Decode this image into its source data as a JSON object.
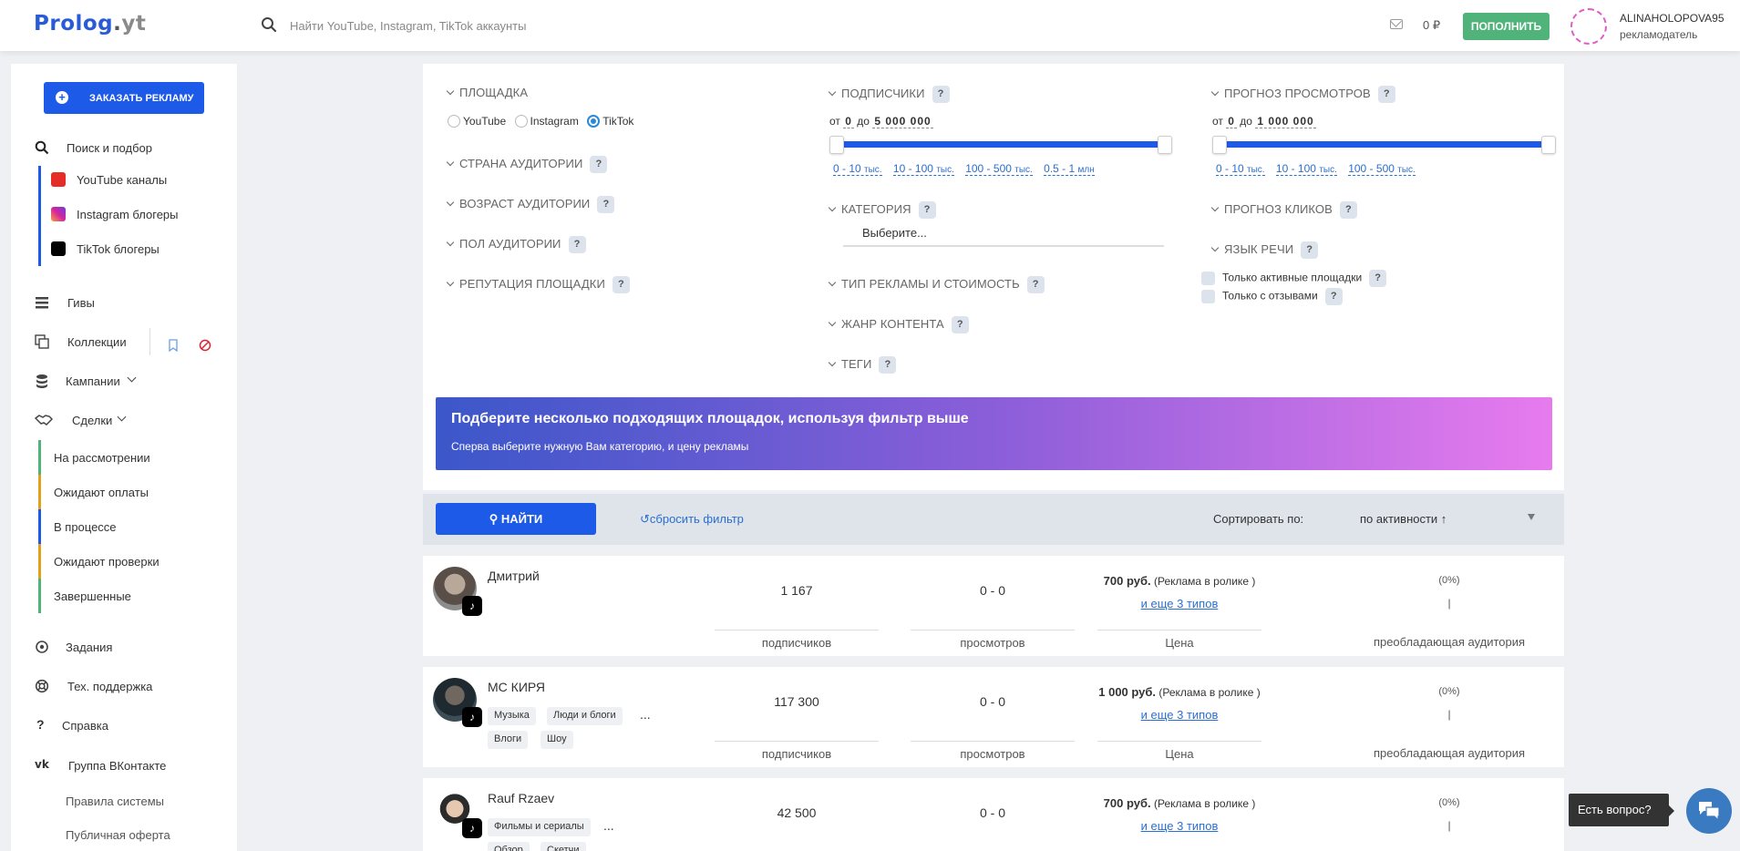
{
  "header": {
    "logo": "Prolog",
    "logo_dot": ".",
    "logo_suffix": "yt",
    "search_placeholder": "Найти YouTube, Instagram, TikTok аккаунты",
    "balance": "0 ₽",
    "topup_label": "ПОПОЛНИТЬ",
    "user_name": "ALINAHOLOPOVA95",
    "user_role": "рекламодатель"
  },
  "sidebar": {
    "order_label": "ЗАКАЗАТЬ РЕКЛАМУ",
    "search": "Поиск и подбор",
    "platforms": [
      "YouTube каналы",
      "Instagram блогеры",
      "TikTok блогеры"
    ],
    "giveaways": "Гивы",
    "collections": "Коллекции",
    "campaigns": "Кампании",
    "deals": "Сделки",
    "deal_states": [
      "На рассмотрении",
      "Ожидают оплаты",
      "В процессе",
      "Ожидают проверки",
      "Завершенные"
    ],
    "deal_colors": [
      "#4fb37a",
      "#e0a11b",
      "#1e5ae8",
      "#e0a11b",
      "#4fb37a"
    ],
    "tasks": "Задания",
    "support": "Тех. поддержка",
    "help": "Справка",
    "vk_group": "Группа ВКонтакте",
    "rules": "Правила системы",
    "offer": "Публичная оферта"
  },
  "filters": {
    "platform_title": "ПЛОЩАДКА",
    "platform_options": [
      "YouTube",
      "Instagram",
      "TikTok"
    ],
    "platform_selected": "TikTok",
    "country": "СТРАНА АУДИТОРИИ",
    "age": "ВОЗРАСТ АУДИТОРИИ",
    "gender": "ПОЛ АУДИТОРИИ",
    "reputation": "РЕПУТАЦИЯ ПЛОЩАДКИ",
    "subscribers_title": "ПОДПИСЧИКИ",
    "sub_from_lbl": "от",
    "sub_from": "0",
    "sub_to_lbl": "до",
    "sub_to": "5 000 000",
    "sub_presets": [
      "0 - 10",
      "10 - 100",
      "100 - 500",
      "0.5 - 1"
    ],
    "sub_units": [
      "тыс.",
      "тыс.",
      "тыс.",
      "млн"
    ],
    "category_title": "КАТЕГОРИЯ",
    "category_placeholder": "Выберите...",
    "ad_type": "ТИП РЕКЛАМЫ И СТОИМОСТЬ",
    "genre": "ЖАНР КОНТЕНТА",
    "tags": "ТЕГИ",
    "views_title": "ПРОГНОЗ ПРОСМОТРОВ",
    "views_from_lbl": "от",
    "views_from": "0",
    "views_to_lbl": "до",
    "views_to": "1 000 000",
    "views_presets": [
      "0 - 10",
      "10 - 100",
      "100 - 500"
    ],
    "views_units": [
      "тыс.",
      "тыс.",
      "тыс."
    ],
    "clicks_title": "ПРОГНОЗ КЛИКОВ",
    "language_title": "ЯЗЫК РЕЧИ",
    "only_active": "Только активные площадки",
    "only_reviews": "Только с отзывами",
    "help_mark": "?"
  },
  "banner": {
    "title": "Подберите несколько подходящих площадок, используя фильтр выше",
    "subtitle": "Сперва выберите нужную Вам категорию, и цену рекламы"
  },
  "toolbar": {
    "find_label": "НАЙТИ",
    "reset_label": "сбросить фильтр",
    "sort_label": "Сортировать по:",
    "sort_value": "по активности ↑"
  },
  "labels": {
    "subscribers": "подписчиков",
    "views": "просмотров",
    "price": "Цена",
    "audience": "преобладающая аудитория",
    "more_types": "и еще 3 типов",
    "pct": "(0%)",
    "bar": "|",
    "ellipsis": "..."
  },
  "cards": [
    {
      "name": "Дмитрий",
      "subscribers": "1 167",
      "views": "0 - 0",
      "price": "700 руб.",
      "price_note": "(Реклама в ролике )",
      "tags": []
    },
    {
      "name": "MC КИРЯ",
      "subscribers": "117 300",
      "views": "0 - 0",
      "price": "1 000 руб.",
      "price_note": "(Реклама в ролике )",
      "tags": [
        "Музыка",
        "Люди и блоги",
        "Влоги",
        "Шоу"
      ]
    },
    {
      "name": "Rauf Rzaev",
      "subscribers": "42 500",
      "views": "0 - 0",
      "price": "700 руб.",
      "price_note": "(Реклама в ролике )",
      "tags": [
        "Фильмы и сериалы",
        "Обзор",
        "Скетчи"
      ]
    }
  ],
  "chat": {
    "question": "Есть вопрос?"
  }
}
